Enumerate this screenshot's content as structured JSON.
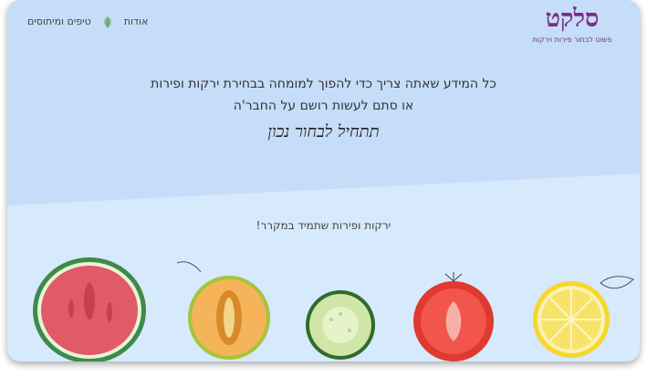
{
  "header": {
    "logo_text": "סלקט",
    "logo_tagline": "פשוט לבחור פירות וירקות",
    "nav": [
      {
        "label": "אודות"
      },
      {
        "label": "טיפים ומיתוסים"
      }
    ]
  },
  "intro": {
    "line1": "כל המידע שאתה צריך כדי להפוך למומחה בבחירת ירקות ופירות",
    "line2": "או סתם לעשות רושם על החבר'ה",
    "script": "תתחיל לבחור נכון"
  },
  "section": {
    "subtitle": "ירקות ופירות שתמיד במקרר!"
  },
  "fruits": [
    {
      "name": "lemon"
    },
    {
      "name": "tomato"
    },
    {
      "name": "cucumber"
    },
    {
      "name": "melon"
    },
    {
      "name": "watermelon"
    }
  ],
  "colors": {
    "brand": "#7a2d86",
    "hero_bg": "#c5ddf8",
    "lower_bg": "#cfe3fb"
  }
}
